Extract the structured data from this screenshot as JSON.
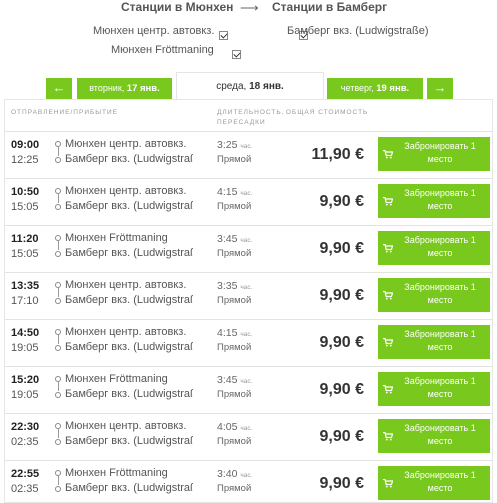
{
  "header": {
    "from_title": "Станции в Мюнхен",
    "to_title": "Станции в Бамберг",
    "from_stations": [
      "Мюнхен центр. автовкз.",
      "Мюнхен Fröttmaning"
    ],
    "to_stations": [
      "Бамберг вкз. (Ludwigstraße)"
    ]
  },
  "dates": {
    "prev_arrow": "←",
    "next_arrow": "→",
    "prev_label": "вторник,",
    "prev_date": "17 янв.",
    "current_label": "среда,",
    "current_date": "18 янв.",
    "next_label": "четверг,",
    "next_date": "19 янв."
  },
  "columns": {
    "departure": "Отправление/Прибытие",
    "duration": "Длительность,",
    "transfers": "Пересадки",
    "price": "Общая стоимость"
  },
  "book_label": "Забронировать 1 место",
  "accent_color": "#78c81e",
  "rows": [
    {
      "dep": "09:00",
      "arr": "12:25",
      "from": "Мюнхен центр. автовкз.",
      "to": "Бамберг вкз. (Ludwigstraße)",
      "dur": "3:25",
      "unit": "час.",
      "type": "Прямой",
      "price": "11,90 €"
    },
    {
      "dep": "10:50",
      "arr": "15:05",
      "from": "Мюнхен центр. автовкз.",
      "to": "Бамберг вкз. (Ludwigstraße)",
      "dur": "4:15",
      "unit": "час.",
      "type": "Прямой",
      "price": "9,90 €"
    },
    {
      "dep": "11:20",
      "arr": "15:05",
      "from": "Мюнхен Fröttmaning",
      "to": "Бамберг вкз. (Ludwigstraße)",
      "dur": "3:45",
      "unit": "час.",
      "type": "Прямой",
      "price": "9,90 €"
    },
    {
      "dep": "13:35",
      "arr": "17:10",
      "from": "Мюнхен центр. автовкз.",
      "to": "Бамберг вкз. (Ludwigstraße)",
      "dur": "3:35",
      "unit": "час.",
      "type": "Прямой",
      "price": "9,90 €"
    },
    {
      "dep": "14:50",
      "arr": "19:05",
      "from": "Мюнхен центр. автовкз.",
      "to": "Бамберг вкз. (Ludwigstraße)",
      "dur": "4:15",
      "unit": "час.",
      "type": "Прямой",
      "price": "9,90 €"
    },
    {
      "dep": "15:20",
      "arr": "19:05",
      "from": "Мюнхен Fröttmaning",
      "to": "Бамберг вкз. (Ludwigstraße)",
      "dur": "3:45",
      "unit": "час.",
      "type": "Прямой",
      "price": "9,90 €"
    },
    {
      "dep": "22:30",
      "arr": "02:35",
      "from": "Мюнхен центр. автовкз.",
      "to": "Бамберг вкз. (Ludwigstraße)",
      "dur": "4:05",
      "unit": "час.",
      "type": "Прямой",
      "price": "9,90 €"
    },
    {
      "dep": "22:55",
      "arr": "02:35",
      "from": "Мюнхен Fröttmaning",
      "to": "Бамберг вкз. (Ludwigstraße)",
      "dur": "3:40",
      "unit": "час.",
      "type": "Прямой",
      "price": "9,90 €"
    }
  ]
}
